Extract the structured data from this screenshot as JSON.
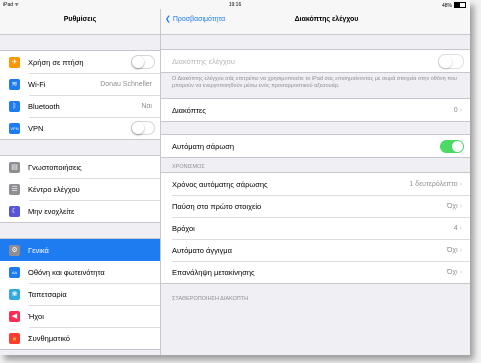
{
  "statusbar": {
    "carrier": "iPad ᯤ",
    "time": "19:16",
    "battery": "48%"
  },
  "sidebar": {
    "title": "Ρυθμίσεις",
    "groups": [
      [
        {
          "label": "Χρήση σε πτήση",
          "icon": "airplane-icon",
          "color": "#ff9500",
          "glyph": "✈",
          "toggle": "off"
        },
        {
          "label": "Wi-Fi",
          "icon": "wifi-icon",
          "color": "#1f7cf0",
          "glyph": "≋",
          "value": "Donau Schneller"
        },
        {
          "label": "Bluetooth",
          "icon": "bluetooth-icon",
          "color": "#1f7cf0",
          "glyph": "ᛒ",
          "value": "Ναι"
        },
        {
          "label": "VPN",
          "icon": "vpn-icon",
          "color": "#1f7cf0",
          "glyph": "VPN",
          "toggle": "off"
        }
      ],
      [
        {
          "label": "Γνωστοποιήσεις",
          "icon": "notifications-icon",
          "color": "#8e8e93",
          "glyph": "▤"
        },
        {
          "label": "Κέντρο ελέγχου",
          "icon": "control-center-icon",
          "color": "#8e8e93",
          "glyph": "☰"
        },
        {
          "label": "Μην ενοχλείτε",
          "icon": "do-not-disturb-icon",
          "color": "#5856d6",
          "glyph": "☾"
        }
      ],
      [
        {
          "label": "Γενικά",
          "icon": "gear-icon",
          "color": "#8e8e93",
          "glyph": "⚙",
          "selected": true
        },
        {
          "label": "Οθόνη και φωτεινότητα",
          "icon": "display-icon",
          "color": "#1f7cf0",
          "glyph": "AA"
        },
        {
          "label": "Ταπετσαρία",
          "icon": "wallpaper-icon",
          "color": "#34aadc",
          "glyph": "❀"
        },
        {
          "label": "Ήχοι",
          "icon": "sounds-icon",
          "color": "#ff2d55",
          "glyph": "◀"
        },
        {
          "label": "Συνθηματικό",
          "icon": "lock-icon",
          "color": "#ff3b30",
          "glyph": "🔒"
        }
      ]
    ]
  },
  "detail": {
    "back_label": "Προσβασιμότητα",
    "title": "Διακόπτης ελέγχου",
    "switch_control_label": "Διακόπτης ελέγχου",
    "switch_control_note": "Ο Διακόπτης ελέγχου σάς επιτρέπει να χρησιμοποιείτε το iPad σας επισημαίνοντας με σειρά στοιχεία στην οθόνη που μπορούν να ενεργοποιηθούν μέσω ενός προσαρμοστικού αξεσουάρ.",
    "switches_label": "Διακόπτες",
    "switches_value": "0",
    "auto_scan_label": "Αυτόματη σάρωση",
    "timing_header": "ΧΡΟΝΙΣΜΟΣ",
    "timing": [
      {
        "label": "Χρόνος αυτόματης σάρωσης",
        "value": "1 δευτερόλεπτο"
      },
      {
        "label": "Παύση στο πρώτο στοιχείο",
        "value": "Όχι"
      },
      {
        "label": "Βρόχοι",
        "value": "4"
      },
      {
        "label": "Αυτόματο άγγιγμα",
        "value": "Όχι"
      },
      {
        "label": "Επανάληψη μετακίνησης",
        "value": "Όχι"
      }
    ],
    "stabilization_header": "ΣΤΑΘΕΡΟΠΟΙΗΣΗ ΔΙΑΚΟΠΤΗ"
  }
}
